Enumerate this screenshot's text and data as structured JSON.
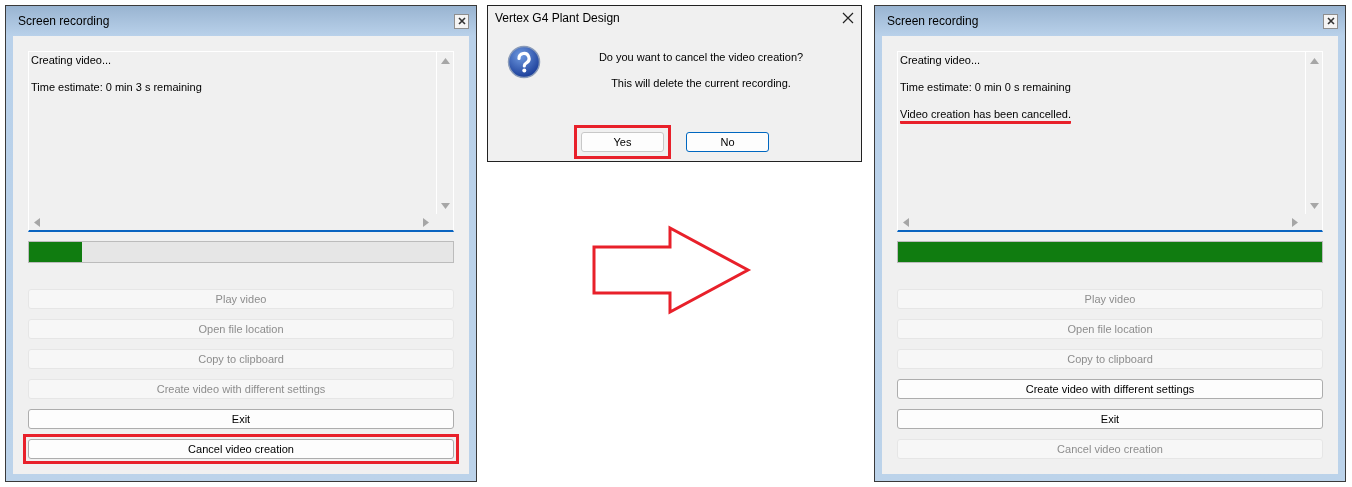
{
  "windows": [
    {
      "title": "Screen recording",
      "log_lines": [
        {
          "text": "Creating video...",
          "underlined": false
        },
        {
          "text": "Time estimate: 0 min 3 s remaining",
          "underlined": false
        }
      ],
      "progress": {
        "level": 0.125
      },
      "buttons": [
        {
          "label": "Play video",
          "disabled": true,
          "highlighted": false
        },
        {
          "label": "Open file location",
          "disabled": true,
          "highlighted": false
        },
        {
          "label": "Copy to clipboard",
          "disabled": true,
          "highlighted": false
        },
        {
          "label": "Create video with different settings",
          "disabled": true,
          "highlighted": false
        },
        {
          "label": "Exit",
          "disabled": false,
          "highlighted": false
        },
        {
          "label": "Cancel video creation",
          "disabled": false,
          "highlighted": true
        }
      ]
    },
    {
      "title": "Screen recording",
      "log_lines": [
        {
          "text": "Creating video...",
          "underlined": false
        },
        {
          "text": "Time estimate: 0 min 0 s remaining",
          "underlined": false
        },
        {
          "text": "Video creation has been cancelled.",
          "underlined": true
        }
      ],
      "progress": {
        "level": 1
      },
      "buttons": [
        {
          "label": "Play video",
          "disabled": true,
          "highlighted": false
        },
        {
          "label": "Open file location",
          "disabled": true,
          "highlighted": false
        },
        {
          "label": "Copy to clipboard",
          "disabled": true,
          "highlighted": false
        },
        {
          "label": "Create video with different settings",
          "disabled": false,
          "highlighted": false
        },
        {
          "label": "Exit",
          "disabled": false,
          "highlighted": false
        },
        {
          "label": "Cancel video creation",
          "disabled": true,
          "highlighted": false
        }
      ]
    }
  ],
  "dialog": {
    "title": "Vertex G4 Plant Design",
    "question": "Do you want to cancel the video creation?",
    "detail": "This will delete the current recording.",
    "buttons": [
      {
        "label": "Yes",
        "highlighted": true,
        "focused": false
      },
      {
        "label": "No",
        "highlighted": false,
        "focused": true
      }
    ]
  }
}
